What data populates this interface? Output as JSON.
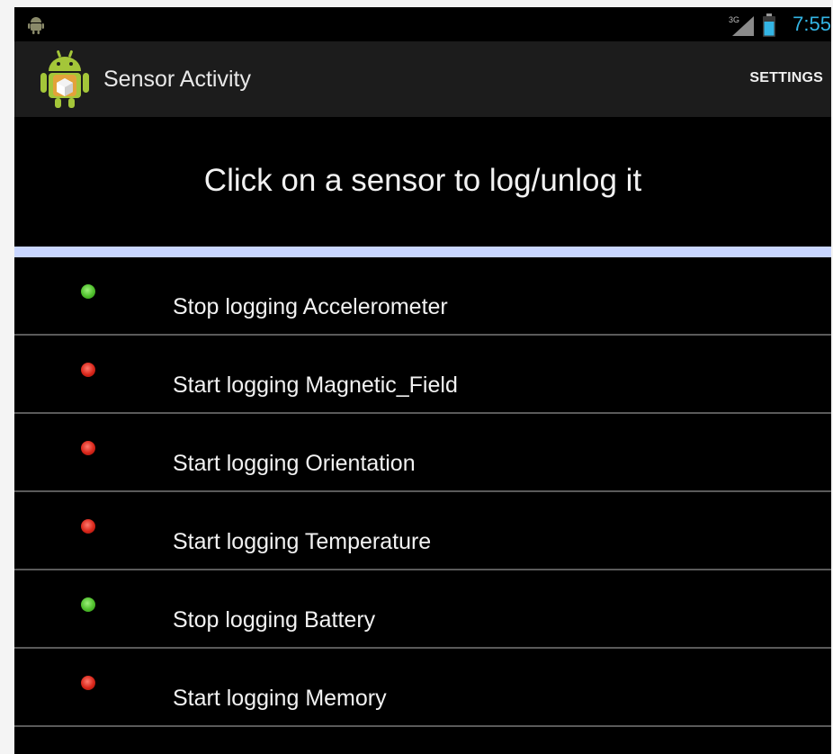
{
  "status_bar": {
    "network_type": "3G",
    "time": "7:55",
    "clock_color": "#33b5e5",
    "icons": [
      "android-notification-icon",
      "signal-icon",
      "battery-icon"
    ]
  },
  "action_bar": {
    "title": "Sensor Activity",
    "settings_label": "SETTINGS",
    "app_icon": "android-app-icon"
  },
  "prompt": "Click on a sensor to log/unlog it",
  "colors": {
    "divider": "#c9d6ff",
    "logging_on": "#4fbf2c",
    "logging_off": "#d8261a"
  },
  "sensors": [
    {
      "label": "Stop logging Accelerometer",
      "status": "on"
    },
    {
      "label": "Start logging Magnetic_Field",
      "status": "off"
    },
    {
      "label": "Start logging Orientation",
      "status": "off"
    },
    {
      "label": "Start logging Temperature",
      "status": "off"
    },
    {
      "label": "Stop logging Battery",
      "status": "on"
    },
    {
      "label": "Start logging Memory",
      "status": "off"
    }
  ]
}
